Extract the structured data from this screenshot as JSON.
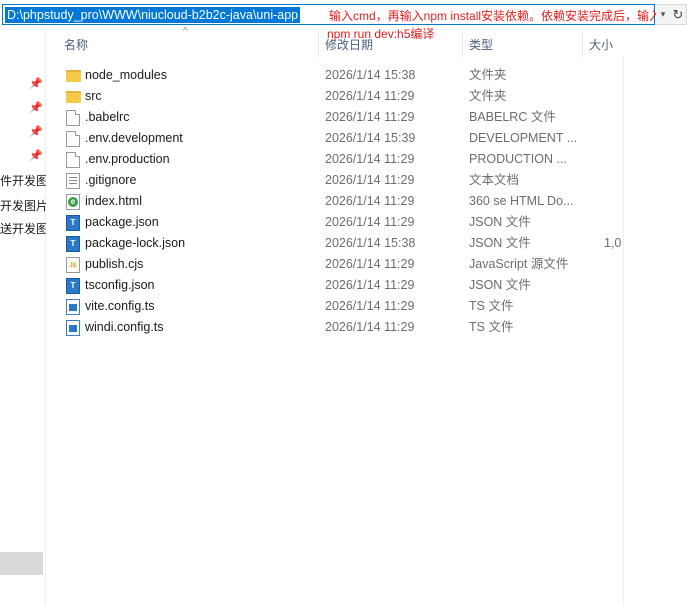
{
  "address_bar": {
    "path": "D:\\phpstudy_pro\\WWW\\niucloud-b2b2c-java\\uni-app",
    "annotation_line1": "输入cmd，再输入npm install安装依赖。依赖安装完成后，输入",
    "annotation_line2": "npm run dev:h5编译",
    "dropdown_icon": "chevron-down-icon",
    "refresh_icon": "refresh-icon"
  },
  "nav_pane": {
    "items": [
      "件开发图片",
      "开发图片",
      "送开发图"
    ]
  },
  "columns": {
    "name": "名称",
    "date": "修改日期",
    "type": "类型",
    "size": "大小"
  },
  "files": [
    {
      "name": "node_modules",
      "date": "2026/1/14 15:38",
      "type": "文件夹",
      "size": "",
      "icon": "folder-icon"
    },
    {
      "name": "src",
      "date": "2026/1/14 11:29",
      "type": "文件夹",
      "size": "",
      "icon": "folder-icon"
    },
    {
      "name": ".babelrc",
      "date": "2026/1/14 11:29",
      "type": "BABELRC 文件",
      "size": "",
      "icon": "file-icon"
    },
    {
      "name": ".env.development",
      "date": "2026/1/14 15:39",
      "type": "DEVELOPMENT ...",
      "size": "",
      "icon": "file-icon"
    },
    {
      "name": ".env.production",
      "date": "2026/1/14 11:29",
      "type": "PRODUCTION ...",
      "size": "",
      "icon": "file-icon"
    },
    {
      "name": ".gitignore",
      "date": "2026/1/14 11:29",
      "type": "文本文档",
      "size": "",
      "icon": "text-file-icon"
    },
    {
      "name": "index.html",
      "date": "2026/1/14 11:29",
      "type": "360 se HTML Do...",
      "size": "",
      "icon": "html-file-icon"
    },
    {
      "name": "package.json",
      "date": "2026/1/14 11:29",
      "type": "JSON 文件",
      "size": "",
      "icon": "typescript-file-icon"
    },
    {
      "name": "package-lock.json",
      "date": "2026/1/14 15:38",
      "type": "JSON 文件",
      "size": "1,0",
      "icon": "typescript-file-icon"
    },
    {
      "name": "publish.cjs",
      "date": "2026/1/14 11:29",
      "type": "JavaScript 源文件",
      "size": "",
      "icon": "javascript-file-icon"
    },
    {
      "name": "tsconfig.json",
      "date": "2026/1/14 11:29",
      "type": "JSON 文件",
      "size": "",
      "icon": "typescript-file-icon"
    },
    {
      "name": "vite.config.ts",
      "date": "2026/1/14 11:29",
      "type": "TS 文件",
      "size": "",
      "icon": "ts-file-icon"
    },
    {
      "name": "windi.config.ts",
      "date": "2026/1/14 11:29",
      "type": "TS 文件",
      "size": "",
      "icon": "ts-file-icon"
    }
  ]
}
